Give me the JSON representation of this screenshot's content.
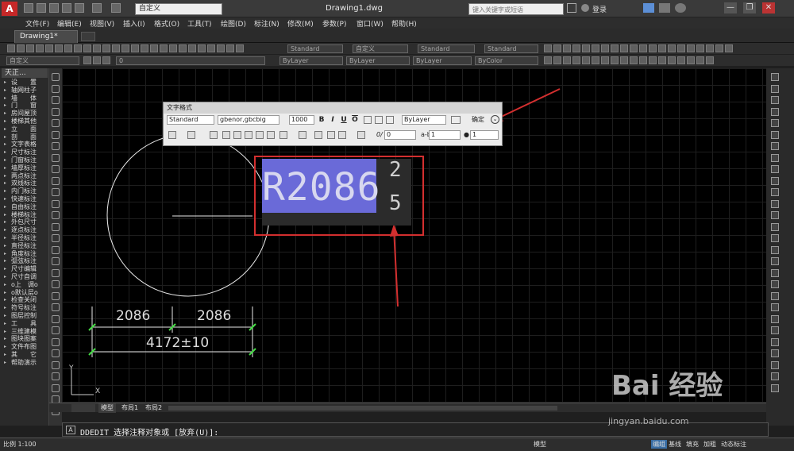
{
  "app": {
    "logo_letter": "A",
    "doc_title": "Drawing1.dwg",
    "workspace": "自定义",
    "search_placeholder": "键入关键字或短语",
    "login": "登录"
  },
  "menu": [
    "文件(F)",
    "编辑(E)",
    "视图(V)",
    "插入(I)",
    "格式(O)",
    "工具(T)",
    "绘图(D)",
    "标注(N)",
    "修改(M)",
    "参数(P)",
    "窗口(W)",
    "帮助(H)"
  ],
  "tab": {
    "name": "Drawing1*"
  },
  "toolbar": {
    "style_combos": [
      "Standard",
      "自定义",
      "Standard",
      "Standard"
    ],
    "layer_combo": "自定义",
    "layer_value": "0",
    "prop_combos": [
      "ByLayer",
      "ByLayer",
      "ByLayer",
      "ByColor"
    ]
  },
  "tianzheng": {
    "title": "天正...",
    "items": [
      "设　　置",
      "轴网柱子",
      "墙　　体",
      "门　　窗",
      "房间屋顶",
      "楼梯其他",
      "立　　面",
      "剖　　面",
      "文字表格",
      "尺寸标注",
      "门窗标注",
      "墙厚标注",
      "两点标注",
      "双线标注",
      "内门标注",
      "快速标注",
      "自由标注",
      "楼梯标注",
      "外包尺寸",
      "逐点标注",
      "半径标注",
      "直径标注",
      "角度标注",
      "弧弦标注",
      "尺寸编辑",
      "尺寸自调",
      "o上　调o",
      "o默认层o",
      "检查关闭",
      "符号标注",
      "图层控制",
      "工　　具",
      "三维建模",
      "图块图案",
      "文件布图",
      "其　　它",
      "帮助演示"
    ]
  },
  "text_formatting": {
    "title": "文字格式",
    "style": "Standard",
    "font": "gbenor,gbcbig",
    "height": "1000",
    "color": "ByLayer",
    "ok": "确定",
    "oblique": "0",
    "tracking": "1",
    "width_factor": "1",
    "bold": "B",
    "italic": "I",
    "underline": "U",
    "overline": "O"
  },
  "editor": {
    "mtext": "R2086",
    "stack_top": "2",
    "stack_bottom": "5"
  },
  "dimensions": {
    "left": "2086",
    "right": "2086",
    "total": "4172±10"
  },
  "ucs": {
    "x": "X",
    "y": "Y"
  },
  "layout_tabs": [
    "模型",
    "布局1",
    "布局2"
  ],
  "command": {
    "text": "DDEDIT 选择注释对象或 [放弃(U)]:"
  },
  "status": {
    "scale": "比例 1:100",
    "items": [
      "模型",
      "编组",
      "基线",
      "填充",
      "加粗",
      "动态标注"
    ]
  },
  "watermark": {
    "brand": "Bai 经验",
    "url": "jingyan.baidu.com"
  },
  "colors": {
    "annotation_red": "#d32f2f",
    "selection": "#6a6ad8",
    "dim_tick": "#44dd44"
  }
}
